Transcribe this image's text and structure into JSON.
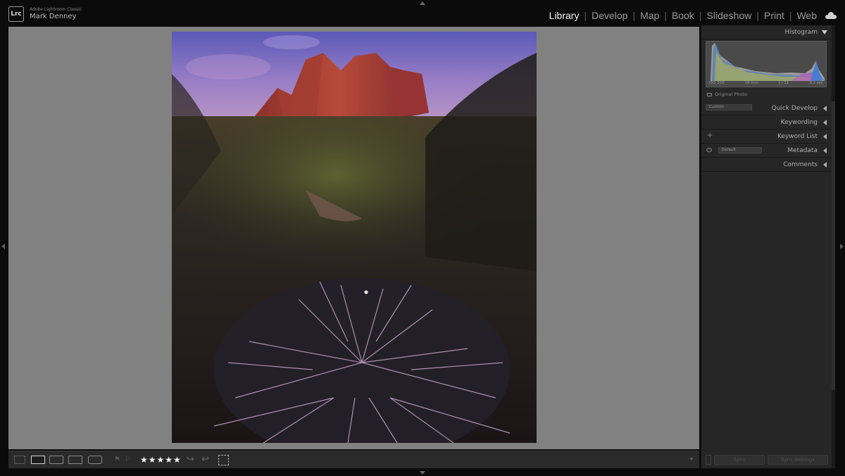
{
  "app": {
    "badge": "Lrc",
    "product_name": "Adobe Lightroom Classic",
    "user_name": "Mark Denney"
  },
  "modules": [
    {
      "label": "Library",
      "active": true
    },
    {
      "label": "Develop",
      "active": false
    },
    {
      "label": "Map",
      "active": false
    },
    {
      "label": "Book",
      "active": false
    },
    {
      "label": "Slideshow",
      "active": false
    },
    {
      "label": "Print",
      "active": false
    },
    {
      "label": "Web",
      "active": false
    }
  ],
  "module_separator": "|",
  "right_panel": {
    "histogram": {
      "title": "Histogram",
      "iso": "ISO 320",
      "focal_length": "16 mm",
      "aperture": "ƒ / 11",
      "shutter": "3.2 sec",
      "original_photo_label": "Original Photo"
    },
    "quick_develop": {
      "title": "Quick Develop",
      "preset_value": "Custom"
    },
    "keywording": {
      "title": "Keywording"
    },
    "keyword_list": {
      "title": "Keyword List",
      "add_symbol": "+"
    },
    "metadata": {
      "title": "Metadata",
      "preset_value": "Default"
    },
    "comments": {
      "title": "Comments"
    },
    "sync_button": "Sync",
    "sync_settings_button": "Sync Settings"
  },
  "toolbar": {
    "rating_stars": "★★★★★",
    "rotate_left_symbol": "↪",
    "rotate_right_symbol": "↩"
  },
  "colors": {
    "active_module": "#f2f2f2",
    "inactive_module": "#9a9a9a",
    "panel_bg": "#262626",
    "center_bg": "#818181"
  }
}
